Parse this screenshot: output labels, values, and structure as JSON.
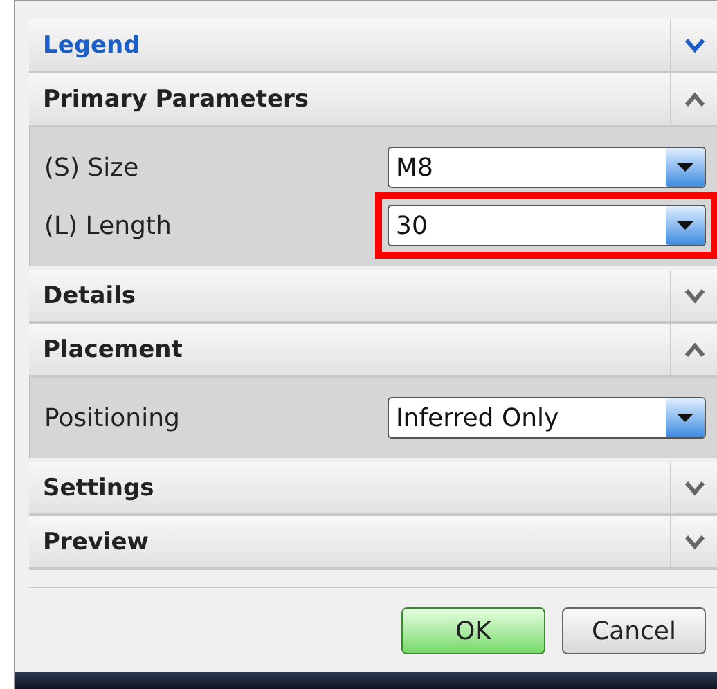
{
  "sections": [
    {
      "title": "Legend",
      "expanded": false,
      "highlighted": true
    },
    {
      "title": "Primary Parameters",
      "expanded": true,
      "highlighted": false,
      "fields": [
        {
          "label": "(S) Size",
          "value": "M8",
          "marked": false
        },
        {
          "label": "(L) Length",
          "value": "30",
          "marked": true
        }
      ]
    },
    {
      "title": "Details",
      "expanded": false,
      "highlighted": false
    },
    {
      "title": "Placement",
      "expanded": true,
      "highlighted": false,
      "fields": [
        {
          "label": "Positioning",
          "value": "Inferred Only",
          "marked": false
        }
      ]
    },
    {
      "title": "Settings",
      "expanded": false,
      "highlighted": false
    },
    {
      "title": "Preview",
      "expanded": false,
      "highlighted": false
    }
  ],
  "buttons": [
    {
      "label": "OK",
      "kind": "primary"
    },
    {
      "label": "Cancel",
      "kind": "secondary"
    }
  ]
}
